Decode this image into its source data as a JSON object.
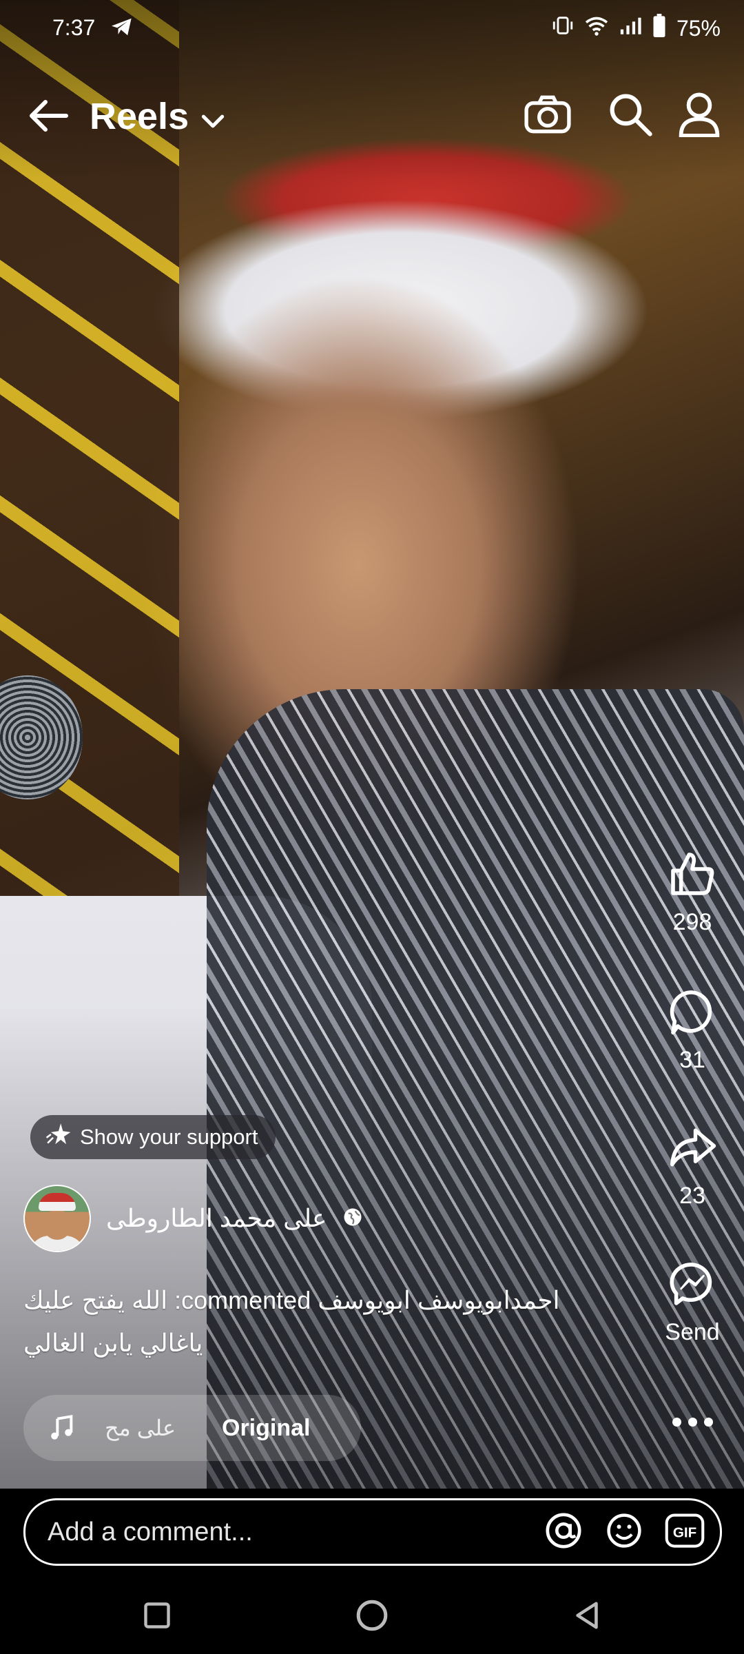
{
  "status_bar": {
    "time": "7:37",
    "battery": "75%",
    "icons": [
      "telegram-icon",
      "vibrate-icon",
      "wifi-icon",
      "signal-icon",
      "battery-icon"
    ]
  },
  "header": {
    "title": "Reels",
    "icons": [
      "back-arrow-icon",
      "chevron-down-icon",
      "camera-icon",
      "search-icon",
      "profile-icon"
    ]
  },
  "actions": {
    "like_count": "298",
    "comment_count": "31",
    "share_count": "23",
    "send_label": "Send"
  },
  "support_button": {
    "label": "Show your support"
  },
  "author": {
    "name": "على محمد الطاروطى",
    "privacy_icon": "globe-icon"
  },
  "caption": {
    "line1": "احمدابويوسف ابويوسف commented: الله يفتح عليك",
    "line2": "ياغالي يابن الغالي"
  },
  "music": {
    "track_left": "على مح",
    "track_right": "Original"
  },
  "comment": {
    "placeholder": "Add a comment...",
    "icons": [
      "mention-icon",
      "emoji-icon",
      "gif-icon"
    ]
  },
  "colors": {
    "accent": "#ffffff",
    "overlay": "#000000",
    "cap_red": "#c8332c"
  }
}
